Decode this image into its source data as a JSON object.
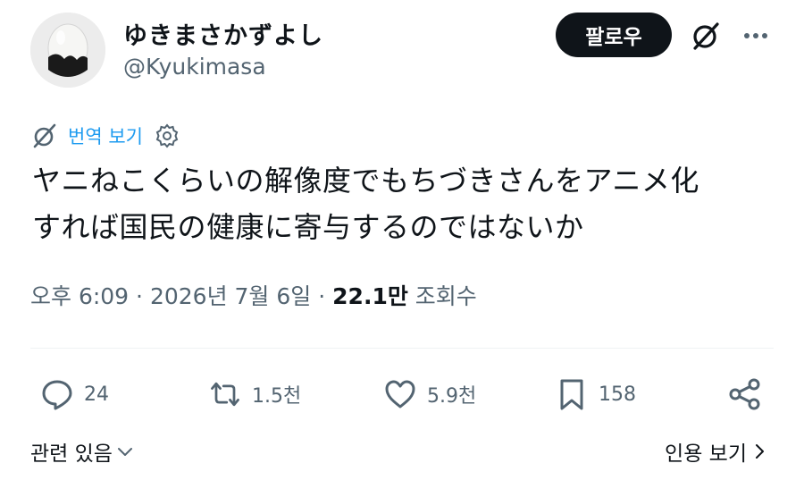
{
  "user": {
    "display_name": "ゆきまさかずよし",
    "handle": "@Kyukimasa"
  },
  "header": {
    "follow_label": "팔로우",
    "grok_icon": "grok-icon",
    "more_icon": "more-icon"
  },
  "translate": {
    "label": "번역 보기",
    "icon": "grok-icon",
    "settings_icon": "gear-icon"
  },
  "tweet": {
    "lines": [
      "ヤニねこくらいの解像度でもちづきさんをアニメ化",
      "すれば国民の健康に寄与するのではないか"
    ]
  },
  "meta": {
    "time": "오후 6:09",
    "separator": "·",
    "date": "2026년 7월 6일",
    "views_count": "22.1만",
    "views_label": "조회수"
  },
  "actions": {
    "replies": "24",
    "reposts": "1.5천",
    "likes": "5.9천",
    "bookmarks": "158"
  },
  "footer": {
    "related_label": "관련 있음",
    "quotes_label": "인용 보기"
  }
}
